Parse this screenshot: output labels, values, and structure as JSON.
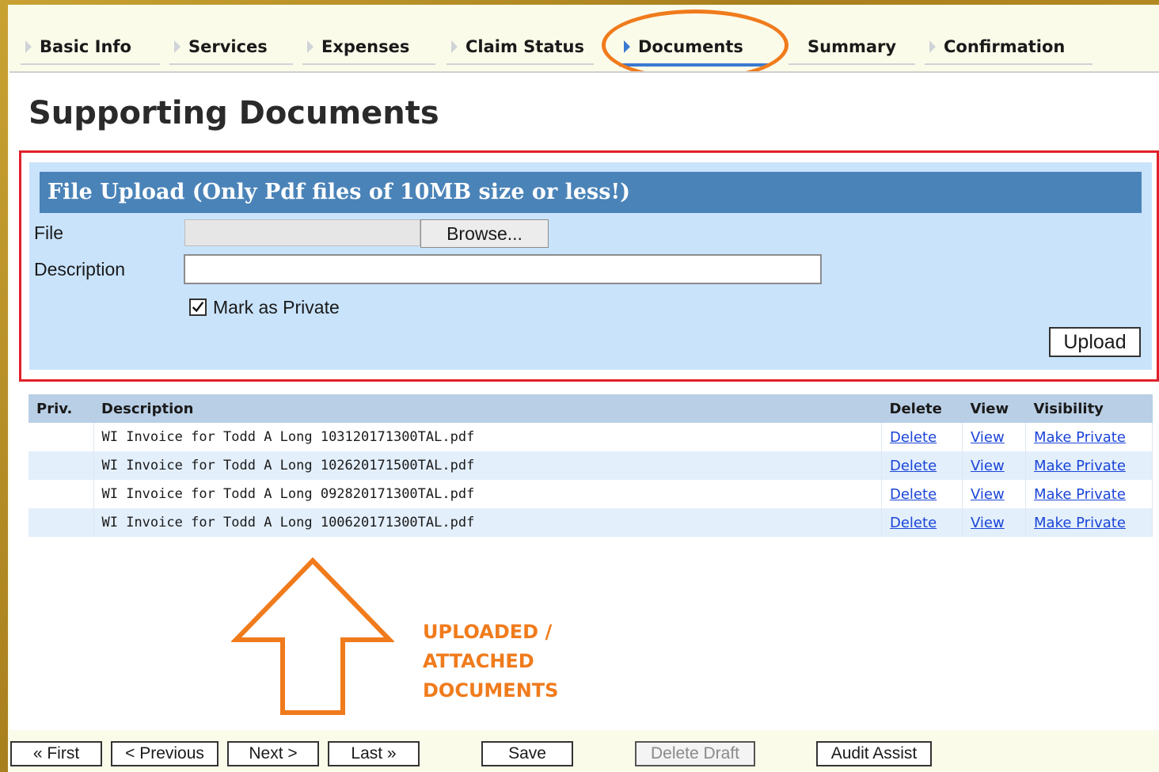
{
  "tabs": [
    {
      "label": "Basic Info",
      "active": false
    },
    {
      "label": "Services",
      "active": false
    },
    {
      "label": "Expenses",
      "active": false
    },
    {
      "label": "Claim Status",
      "active": false
    },
    {
      "label": "Documents",
      "active": true
    },
    {
      "label": "Summary",
      "active": false
    },
    {
      "label": "Confirmation",
      "active": false
    }
  ],
  "page": {
    "title": "Supporting Documents"
  },
  "upload": {
    "header": "File Upload (Only Pdf files of 10MB size or less!)",
    "file_label": "File",
    "browse_label": "Browse...",
    "description_label": "Description",
    "description_value": "",
    "private_label": "Mark as Private",
    "private_checked": true,
    "upload_label": "Upload"
  },
  "table": {
    "headers": {
      "priv": "Priv.",
      "description": "Description",
      "delete": "Delete",
      "view": "View",
      "visibility": "Visibility"
    },
    "rows": [
      {
        "priv": "",
        "description": "WI Invoice for Todd A Long 103120171300TAL.pdf",
        "delete": "Delete",
        "view": "View",
        "visibility": "Make Private"
      },
      {
        "priv": "",
        "description": "WI Invoice for Todd A Long 102620171500TAL.pdf",
        "delete": "Delete",
        "view": "View",
        "visibility": "Make Private"
      },
      {
        "priv": "",
        "description": "WI Invoice for Todd A Long 092820171300TAL.pdf",
        "delete": "Delete",
        "view": "View",
        "visibility": "Make Private"
      },
      {
        "priv": "",
        "description": "WI Invoice for Todd A Long 100620171300TAL.pdf",
        "delete": "Delete",
        "view": "View",
        "visibility": "Make Private"
      }
    ]
  },
  "annotation": {
    "line1": "UPLOADED /",
    "line2": "ATTACHED",
    "line3": "DOCUMENTS"
  },
  "footer": {
    "first": "« First",
    "previous": "< Previous",
    "next": "Next >",
    "last": "Last »",
    "save": "Save",
    "delete_draft": "Delete Draft",
    "audit_assist": "Audit Assist"
  },
  "colors": {
    "accent_orange": "#f07b1c",
    "highlight_red": "#e0202a",
    "header_blue": "#4a83b8",
    "link_blue": "#1a44d8"
  }
}
